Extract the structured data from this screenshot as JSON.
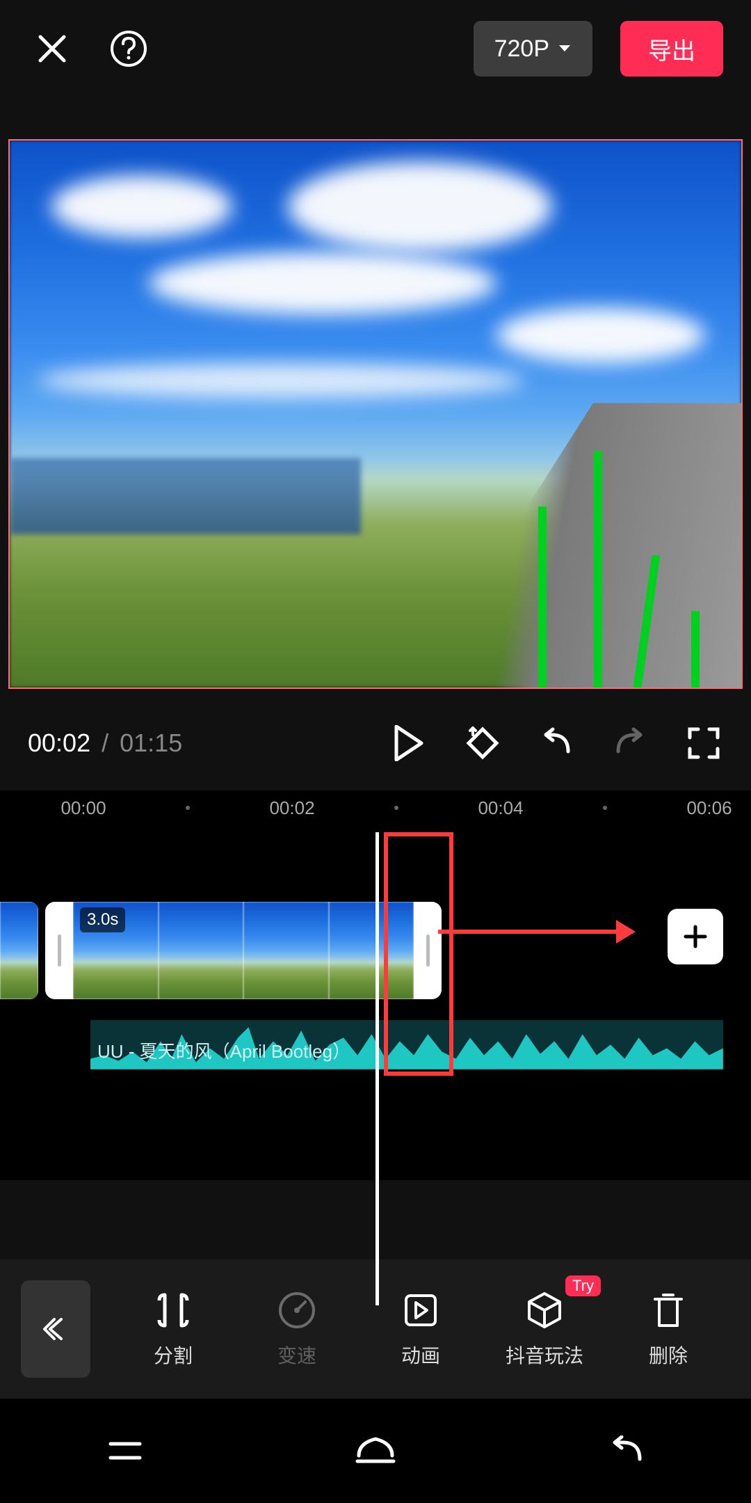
{
  "header": {
    "resolution": "720P",
    "export": "导出"
  },
  "time": {
    "current": "00:02",
    "separator": "/",
    "total": "01:15"
  },
  "ruler": {
    "t0": "00:00",
    "t1": "00:02",
    "t2": "00:04",
    "t3": "00:06"
  },
  "clip": {
    "duration": "3.0s"
  },
  "audio": {
    "label": "UU - 夏天的风（April Bootleg）"
  },
  "tools": {
    "split": "分割",
    "speed": "变速",
    "anim": "动画",
    "douyin": "抖音玩法",
    "delete": "删除",
    "try": "Try"
  }
}
